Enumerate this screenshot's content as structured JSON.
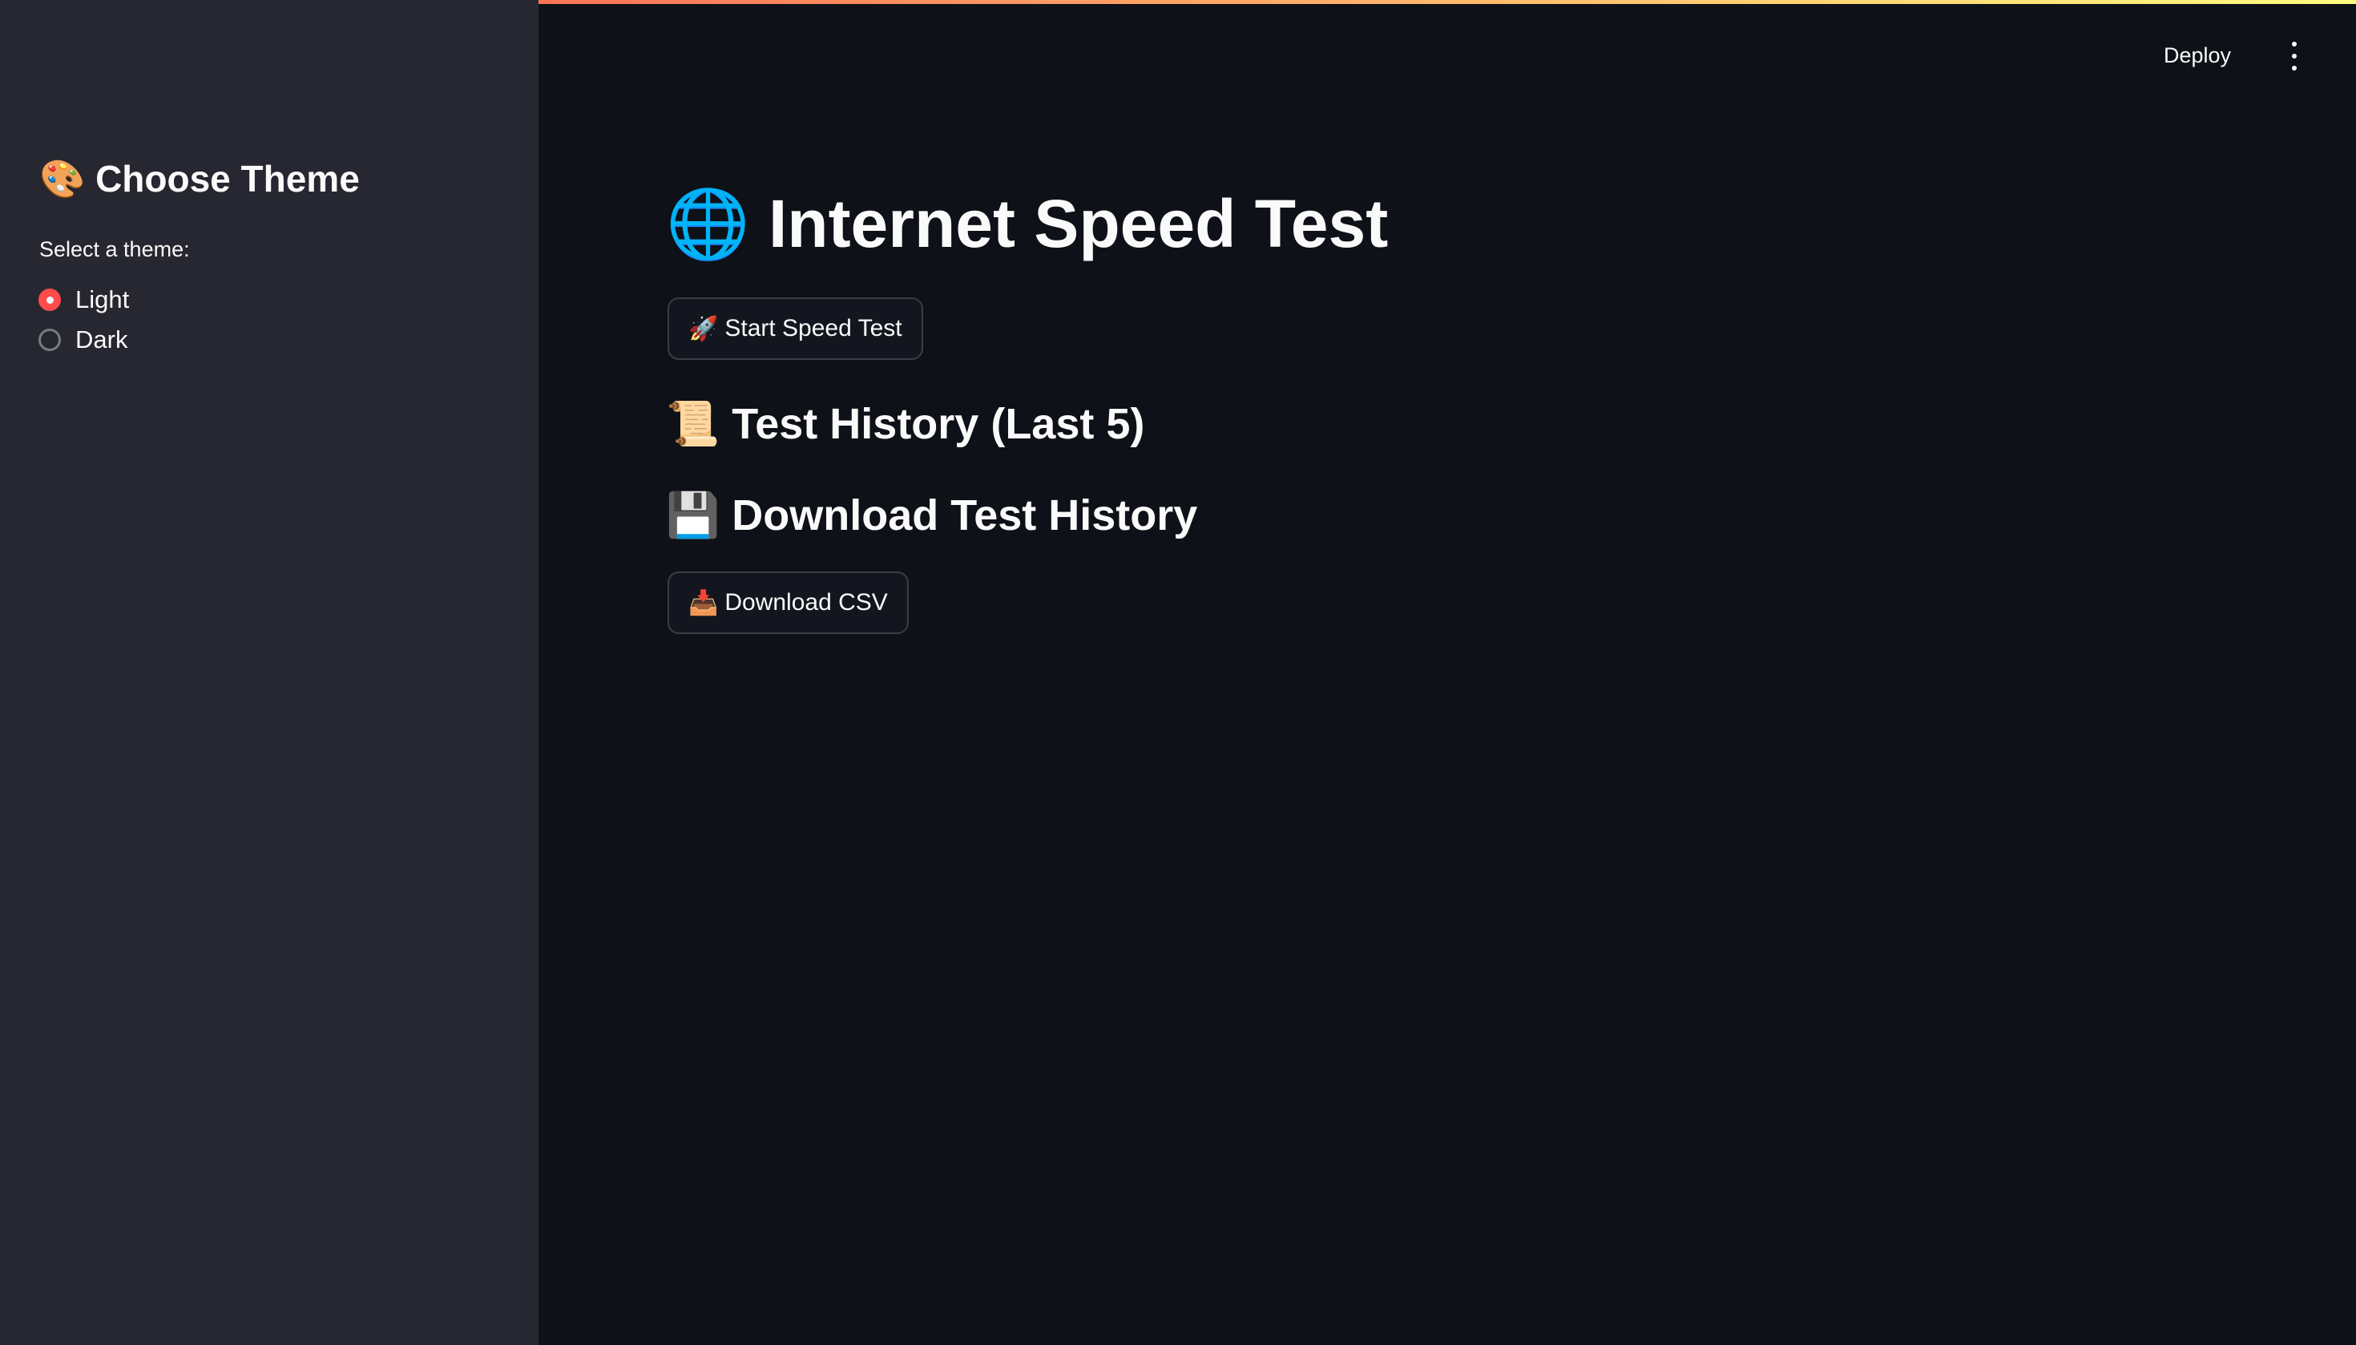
{
  "header": {
    "deploy_label": "Deploy",
    "menu_icon": "vertical-dots-icon",
    "accent_gradient": [
      "#ff4b4b",
      "#fffd80"
    ]
  },
  "sidebar": {
    "title_icon": "🎨",
    "title": "Choose Theme",
    "radio_label": "Select a theme:",
    "options": [
      {
        "label": "Light",
        "selected": true
      },
      {
        "label": "Dark",
        "selected": false
      }
    ],
    "accent_color": "#ff4b4b"
  },
  "main": {
    "title_icon": "🌐",
    "title": "Internet Speed Test",
    "start_button": {
      "icon": "🚀",
      "label": "Start Speed Test"
    },
    "history_heading": {
      "icon": "📜",
      "label": "Test History (Last 5)"
    },
    "download_heading": {
      "icon": "💾",
      "label": "Download Test History"
    },
    "download_button": {
      "icon": "📥",
      "label": "Download CSV"
    }
  }
}
